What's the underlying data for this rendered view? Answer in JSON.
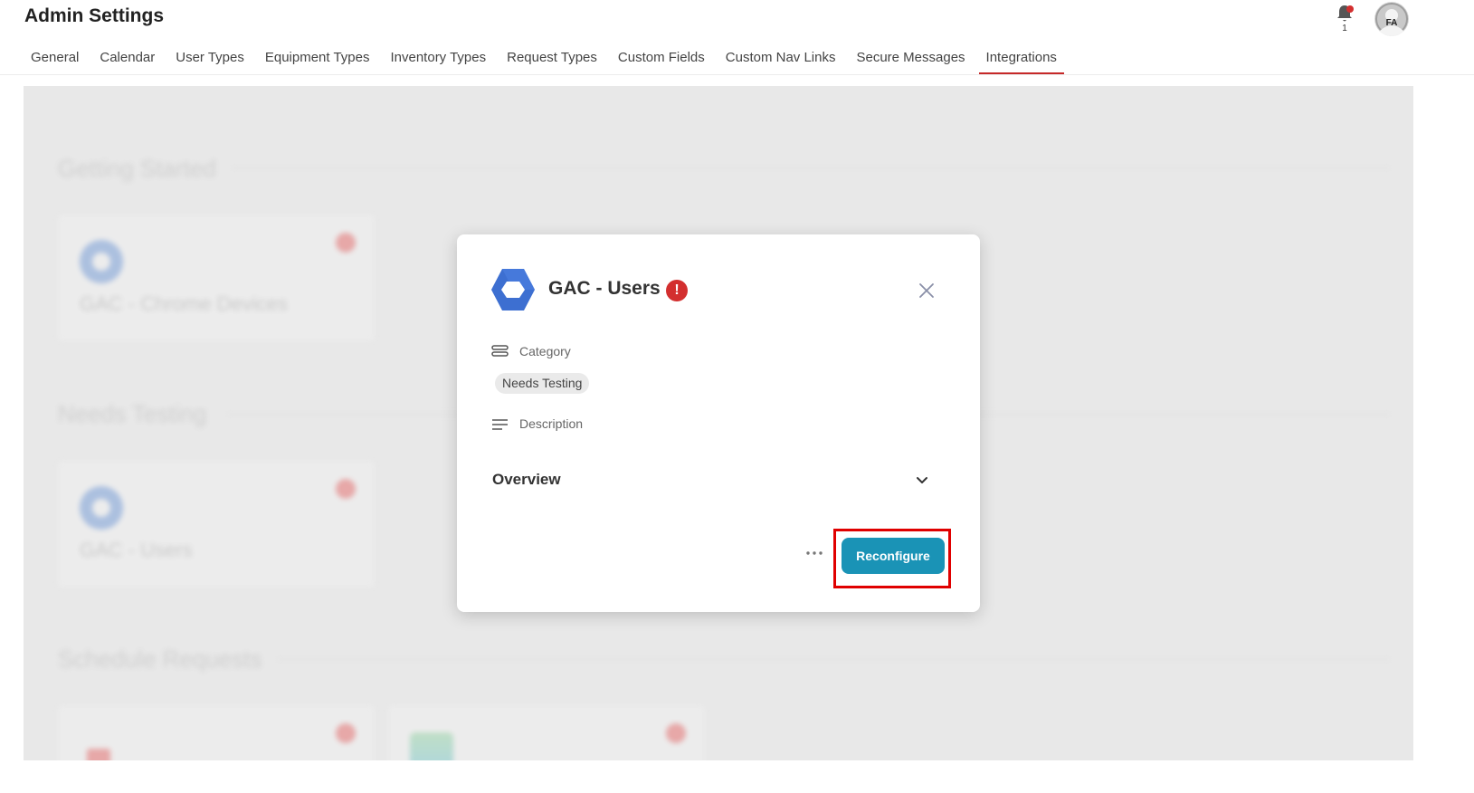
{
  "header": {
    "title": "Admin Settings",
    "notification_count": "1",
    "avatar_initials": "FA"
  },
  "tabs": [
    {
      "label": "General"
    },
    {
      "label": "Calendar"
    },
    {
      "label": "User Types"
    },
    {
      "label": "Equipment Types"
    },
    {
      "label": "Inventory Types"
    },
    {
      "label": "Request Types"
    },
    {
      "label": "Custom Fields"
    },
    {
      "label": "Custom Nav Links"
    },
    {
      "label": "Secure Messages"
    },
    {
      "label": "Integrations",
      "active": true
    }
  ],
  "background": {
    "sections": [
      {
        "title": "Getting Started",
        "cards": [
          "GAC - Chrome Devices"
        ]
      },
      {
        "title": "Needs Testing",
        "cards": [
          "GAC - Users"
        ]
      },
      {
        "title": "Schedule Requests",
        "cards": [
          "",
          ""
        ]
      }
    ]
  },
  "modal": {
    "title": "GAC - Users",
    "alert_glyph": "!",
    "category_label": "Category",
    "category_value": "Needs Testing",
    "description_label": "Description",
    "overview_label": "Overview",
    "more_label": "···",
    "primary_button": "Reconfigure"
  },
  "colors": {
    "accent": "#1a93b6",
    "active_tab_underline": "#c62828",
    "alert": "#d32f2f",
    "highlight_box": "#e00000",
    "logo_blue": "#3d6fd1"
  },
  "icons": {
    "notification": "bell-icon",
    "avatar": "user-avatar-icon",
    "close": "close-icon",
    "category": "stack-icon",
    "description": "text-lines-icon",
    "overview_toggle": "chevron-down-icon",
    "more": "more-horizontal-icon",
    "alert": "exclamation-icon"
  }
}
